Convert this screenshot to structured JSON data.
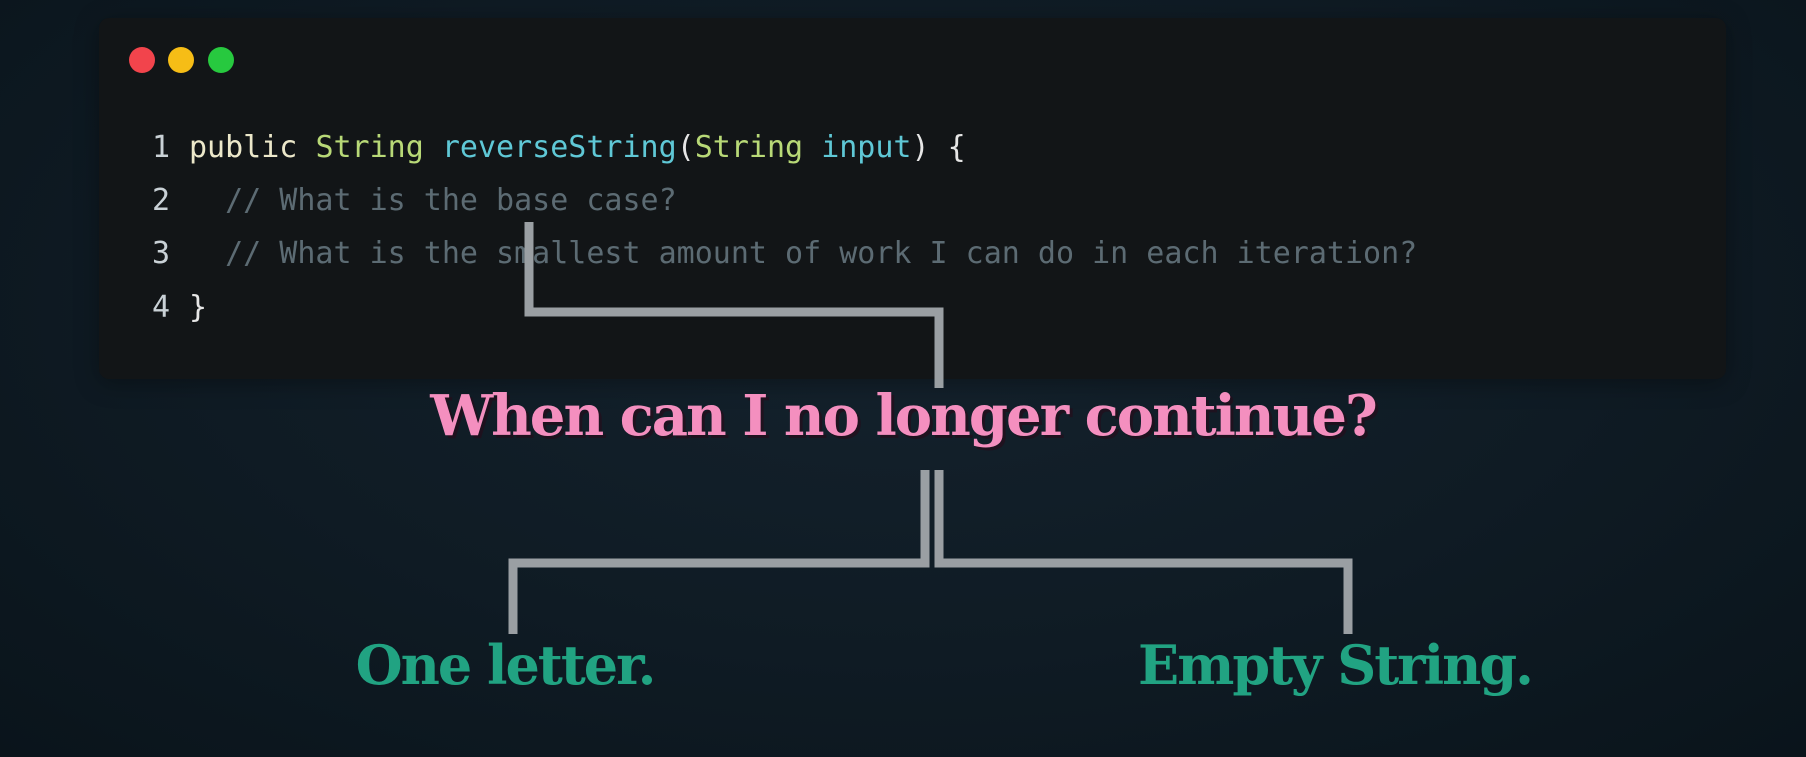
{
  "window": {
    "controls": [
      "close",
      "minimize",
      "maximize"
    ],
    "colors": {
      "close": "#f2444c",
      "minimize": "#f6bd16",
      "maximize": "#27c93f"
    }
  },
  "code": {
    "lines": [
      {
        "number": "1",
        "tokens": [
          "public",
          "String",
          "reverseString",
          "(",
          "String",
          "input",
          ") {"
        ]
      },
      {
        "number": "2",
        "comment": "// What is the base case?"
      },
      {
        "number": "3",
        "comment": "// What is the smallest amount of work I can do in each iteration?"
      },
      {
        "number": "4",
        "text": "}"
      }
    ]
  },
  "diagram": {
    "question": "When can I no longer continue?",
    "answers": [
      "One letter.",
      "Empty String."
    ]
  },
  "colors": {
    "question": "#f48fbf",
    "answer": "#21a382",
    "connector": "#9a9fa3"
  }
}
